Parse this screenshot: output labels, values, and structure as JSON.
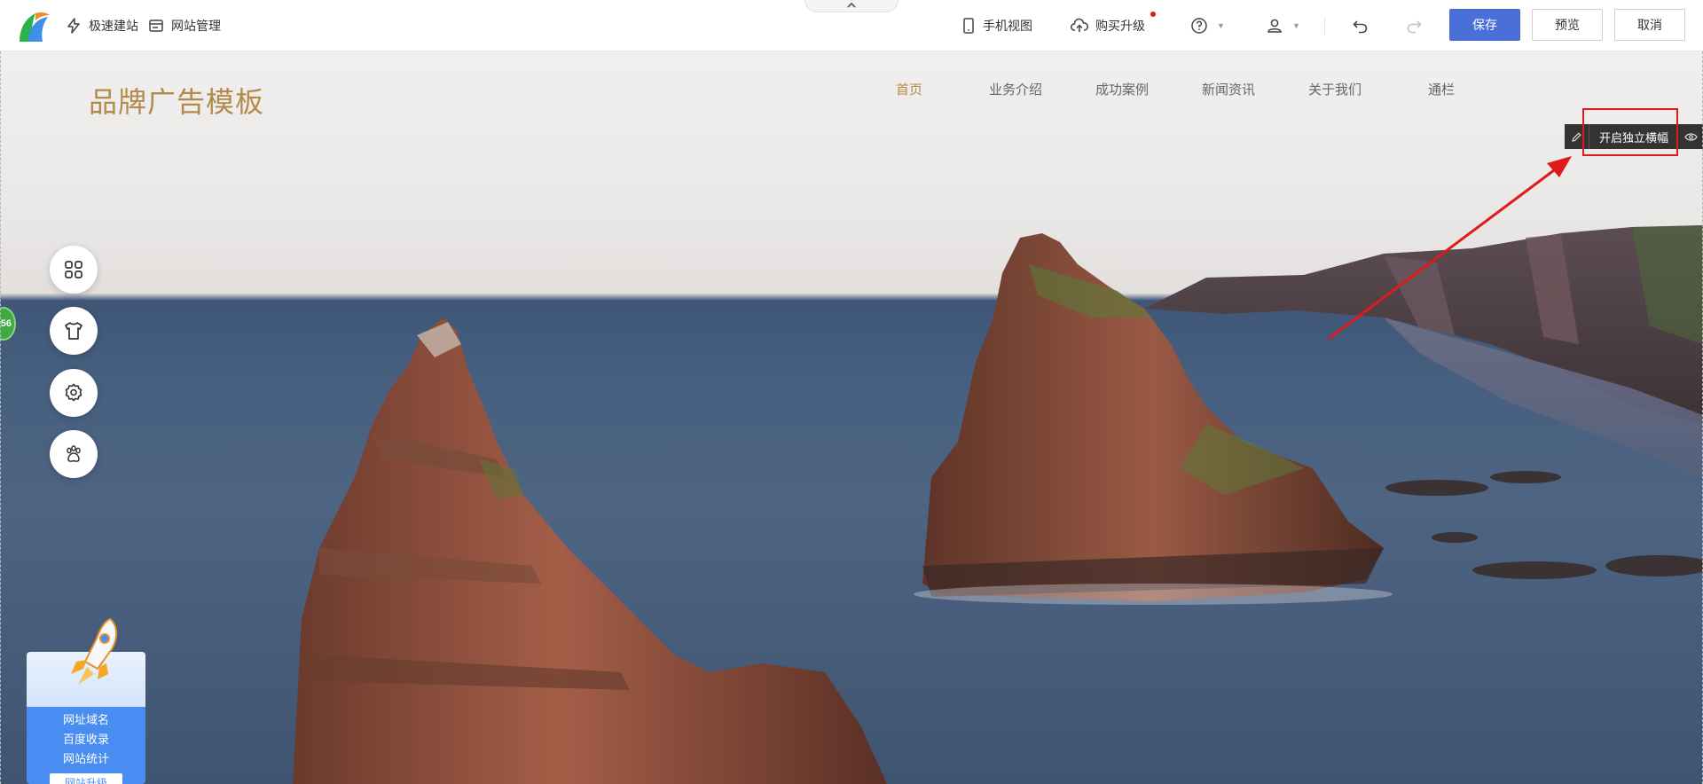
{
  "toolbar": {
    "quick_build": "极速建站",
    "site_manage": "网站管理",
    "mobile_view": "手机视图",
    "buy_upgrade": "购买升级",
    "save": "保存",
    "preview": "预览",
    "cancel": "取消"
  },
  "site": {
    "brand": "品牌广告模板",
    "nav": [
      "首页",
      "业务介绍",
      "成功案例",
      "新闻资讯",
      "关于我们",
      "通栏"
    ]
  },
  "module_bar": {
    "label": "开启独立横幅"
  },
  "side_badge": "56",
  "promo": {
    "lines": [
      "网址域名",
      "百度收录",
      "网站统计"
    ],
    "button": "网站升级"
  },
  "colors": {
    "accent": "#4a6fd8",
    "brand": "#b28a4a",
    "annotation": "#e01a1a",
    "promo": "#4a8df2"
  }
}
